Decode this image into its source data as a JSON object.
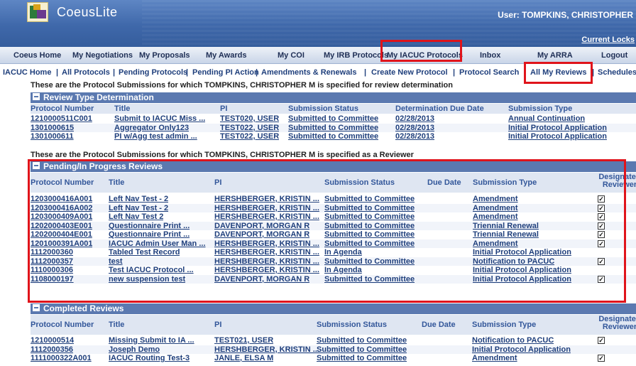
{
  "header": {
    "app_name": "CoeusLite",
    "user_info": "User: TOMPKINS, CHRISTOPHER",
    "current_locks": "Current Locks"
  },
  "main_nav": [
    {
      "label": "Coeus Home"
    },
    {
      "label": "My Negotiations"
    },
    {
      "label": "My Proposals"
    },
    {
      "label": "My Awards"
    },
    {
      "label": "My COI"
    },
    {
      "label": "My IRB Protocols"
    },
    {
      "label": "My IACUC Protocols"
    },
    {
      "label": "Inbox"
    },
    {
      "label": "My ARRA"
    },
    {
      "label": "Logout"
    }
  ],
  "sub_nav": [
    {
      "label": "IACUC Home"
    },
    {
      "label": "All Protocols"
    },
    {
      "label": "Pending Protocols"
    },
    {
      "label": "Pending PI Action"
    },
    {
      "label": "Amendments & Renewals"
    },
    {
      "label": "Create New Protocol"
    },
    {
      "label": "Protocol Search"
    },
    {
      "label": "All My Reviews"
    },
    {
      "label": "Schedules"
    }
  ],
  "intro_determination": "These are the Protocol Submissions for which TOMPKINS, CHRISTOPHER M is specified for review determination",
  "intro_reviewer": "These are the Protocol Submissions for which TOMPKINS, CHRISTOPHER M is specified as a Reviewer",
  "review_type": {
    "title": "Review Type Determination",
    "headers": [
      "Protocol Number",
      "Title",
      "PI",
      "Submission Status",
      "Determination Due Date",
      "Submission Type"
    ],
    "rows": [
      [
        "1210000511C001",
        "Submit to IACUC Miss ...",
        "TEST020, USER",
        "Submitted to Committee",
        "02/28/2013",
        "Annual Continuation"
      ],
      [
        "1301000615",
        "Aggregator Only123",
        "TEST022, USER",
        "Submitted to Committee",
        "02/28/2013",
        "Initial Protocol Application"
      ],
      [
        "1301000611",
        "PI w/Agg test admin ...",
        "TEST022, USER",
        "Submitted to Committee",
        "02/28/2013",
        "Initial Protocol Application"
      ]
    ]
  },
  "pending": {
    "title": "Pending/In Progress Reviews",
    "headers": [
      "Protocol Number",
      "Title",
      "PI",
      "Submission Status",
      "Due Date",
      "Submission Type",
      "Designated",
      "Reviewer"
    ],
    "rows": [
      {
        "num": "1203000416A001",
        "title": "Left Nav Test - 2",
        "pi": "HERSHBERGER, KRISTIN ...",
        "status": "Submitted to Committee",
        "due": "",
        "type": "Amendment",
        "designated": true
      },
      {
        "num": "1203000416A002",
        "title": "Left Nav Test - 2",
        "pi": "HERSHBERGER, KRISTIN ...",
        "status": "Submitted to Committee",
        "due": "",
        "type": "Amendment",
        "designated": true
      },
      {
        "num": "1203000409A001",
        "title": "Left Nav Test 2",
        "pi": "HERSHBERGER, KRISTIN ...",
        "status": "Submitted to Committee",
        "due": "",
        "type": "Amendment",
        "designated": true
      },
      {
        "num": "1202000403E001",
        "title": "Questionnaire Print ...",
        "pi": "DAVENPORT, MORGAN R",
        "status": "Submitted to Committee",
        "due": "",
        "type": "Triennial Renewal",
        "designated": true
      },
      {
        "num": "1202000404E001",
        "title": "Questionnaire Print ...",
        "pi": "DAVENPORT, MORGAN R",
        "status": "Submitted to Committee",
        "due": "",
        "type": "Triennial Renewal",
        "designated": true
      },
      {
        "num": "1201000391A001",
        "title": "IACUC Admin User Man ...",
        "pi": "HERSHBERGER, KRISTIN ...",
        "status": "Submitted to Committee",
        "due": "",
        "type": "Amendment",
        "designated": true
      },
      {
        "num": "1112000360",
        "title": "Tabled Test Record",
        "pi": "HERSHBERGER, KRISTIN ...",
        "status": "In Agenda",
        "due": "",
        "type": "Initial Protocol Application",
        "designated": false
      },
      {
        "num": "1112000357",
        "title": "test",
        "pi": "HERSHBERGER, KRISTIN ...",
        "status": "Submitted to Committee",
        "due": "",
        "type": "Notification to PACUC",
        "designated": true
      },
      {
        "num": "1110000306",
        "title": "Test IACUC Protocol ...",
        "pi": "HERSHBERGER, KRISTIN ...",
        "status": "In Agenda",
        "due": "",
        "type": "Initial Protocol Application",
        "designated": false
      },
      {
        "num": "1108000197",
        "title": "new suspension test",
        "pi": "DAVENPORT, MORGAN R",
        "status": "Submitted to Committee",
        "due": "",
        "type": "Initial Protocol Application",
        "designated": true
      }
    ]
  },
  "completed": {
    "title": "Completed Reviews",
    "headers": [
      "Protocol Number",
      "Title",
      "PI",
      "Submission Status",
      "Due Date",
      "Submission Type",
      "Designated",
      "Reviewer"
    ],
    "rows": [
      {
        "num": "1210000514",
        "title": "Missing Submit to IA ...",
        "pi": "TEST021, USER",
        "status": "Submitted to Committee",
        "due": "",
        "type": "Notification to PACUC",
        "designated": true
      },
      {
        "num": "1112000356",
        "title": "Joseph Demo",
        "pi": "HERSHBERGER, KRISTIN ...",
        "status": "Submitted to Committee",
        "due": "",
        "type": "Initial Protocol Application",
        "designated": false
      },
      {
        "num": "1111000322A001",
        "title": "IACUC Routing Test-3",
        "pi": "JANLE, ELSA M",
        "status": "Submitted to Committee",
        "due": "",
        "type": "Amendment",
        "designated": true
      }
    ]
  },
  "colors": {
    "banner": "#3f68aa",
    "section_bar": "#5b79b0",
    "link": "#1f3f7c",
    "highlight": "#e0141b"
  }
}
